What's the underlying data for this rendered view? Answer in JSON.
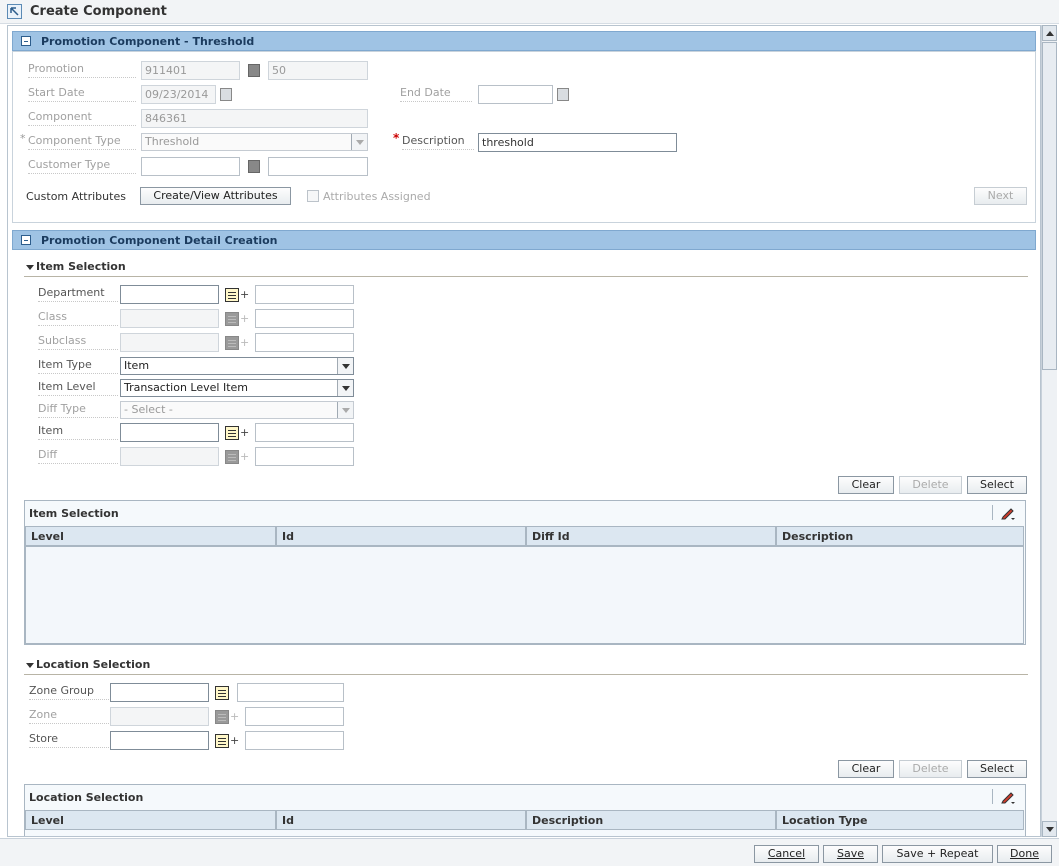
{
  "window": {
    "title": "Create Component"
  },
  "promo_section": {
    "header": "Promotion Component - Threshold",
    "promotion_label": "Promotion",
    "promotion_id": "911401",
    "promotion_num": "50",
    "start_date_label": "Start Date",
    "start_date": "09/23/2014",
    "end_date_label": "End Date",
    "end_date": "",
    "component_label": "Component",
    "component_id": "846361",
    "component_type_label": "Component Type",
    "component_type": "Threshold",
    "description_label": "Description",
    "description": "threshold",
    "customer_type_label": "Customer Type",
    "customer_type_code": "",
    "customer_type_desc": "",
    "custom_attributes_label": "Custom Attributes",
    "create_view_button": "Create/View Attributes",
    "attributes_assigned_label": "Attributes Assigned",
    "next_button": "Next"
  },
  "detail_section": {
    "header": "Promotion Component Detail Creation",
    "item_selection": {
      "header": "Item Selection",
      "department_label": "Department",
      "class_label": "Class",
      "subclass_label": "Subclass",
      "item_type_label": "Item Type",
      "item_type": "Item",
      "item_level_label": "Item Level",
      "item_level": "Transaction Level Item",
      "diff_type_label": "Diff Type",
      "diff_type": "- Select -",
      "item_label": "Item",
      "diff_label": "Diff",
      "clear_button": "Clear",
      "delete_button": "Delete",
      "select_button": "Select",
      "table_title": "Item Selection",
      "columns": [
        "Level",
        "Id",
        "Diff Id",
        "Description"
      ]
    },
    "location_selection": {
      "header": "Location Selection",
      "zone_group_label": "Zone Group",
      "zone_label": "Zone",
      "store_label": "Store",
      "clear_button": "Clear",
      "delete_button": "Delete",
      "select_button": "Select",
      "table_title": "Location Selection",
      "columns": [
        "Level",
        "Id",
        "Description",
        "Location Type"
      ]
    }
  },
  "footer": {
    "cancel": "Cancel",
    "save": "Save",
    "save_repeat": "Save + Repeat",
    "done": "Done"
  }
}
